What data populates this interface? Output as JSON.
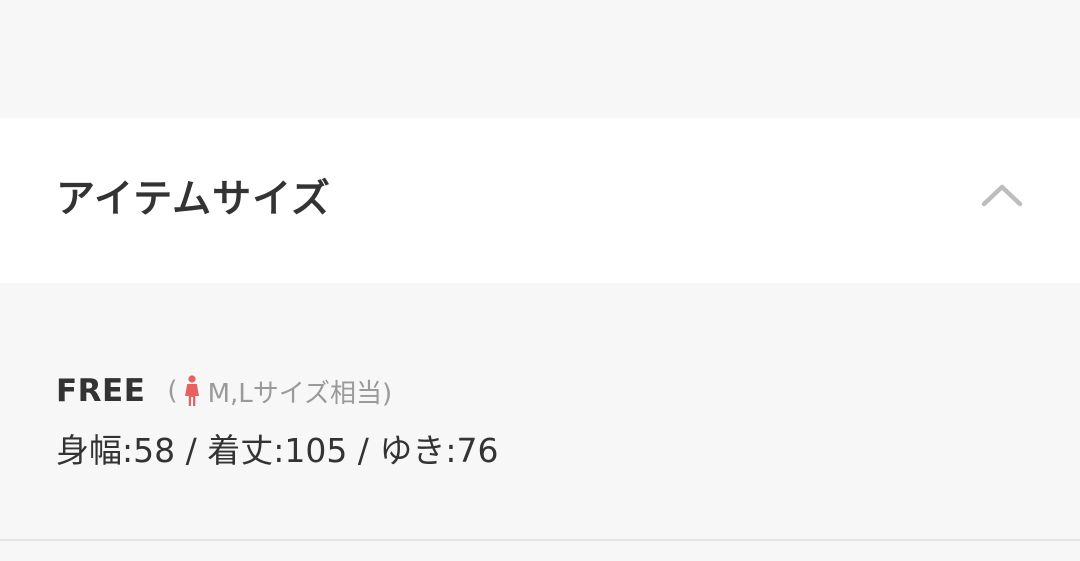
{
  "accordion": {
    "title": "アイテムサイズ",
    "expanded": true,
    "toggle_icon": "chevron-up-icon"
  },
  "size": {
    "name": "FREE",
    "equiv_open": "(",
    "equiv_icon": "woman-figure-icon",
    "equiv_icon_color": "#e8615f",
    "equiv_text": "M,Lサイズ相当)",
    "measurements": "身幅:58 / 着丈:105 / ゆき:76"
  },
  "colors": {
    "background": "#f7f7f7",
    "header_background": "#ffffff",
    "text": "#333333",
    "muted_text": "#9a9a9a",
    "chevron": "#bdbdbd",
    "divider": "#e4e4e4"
  }
}
